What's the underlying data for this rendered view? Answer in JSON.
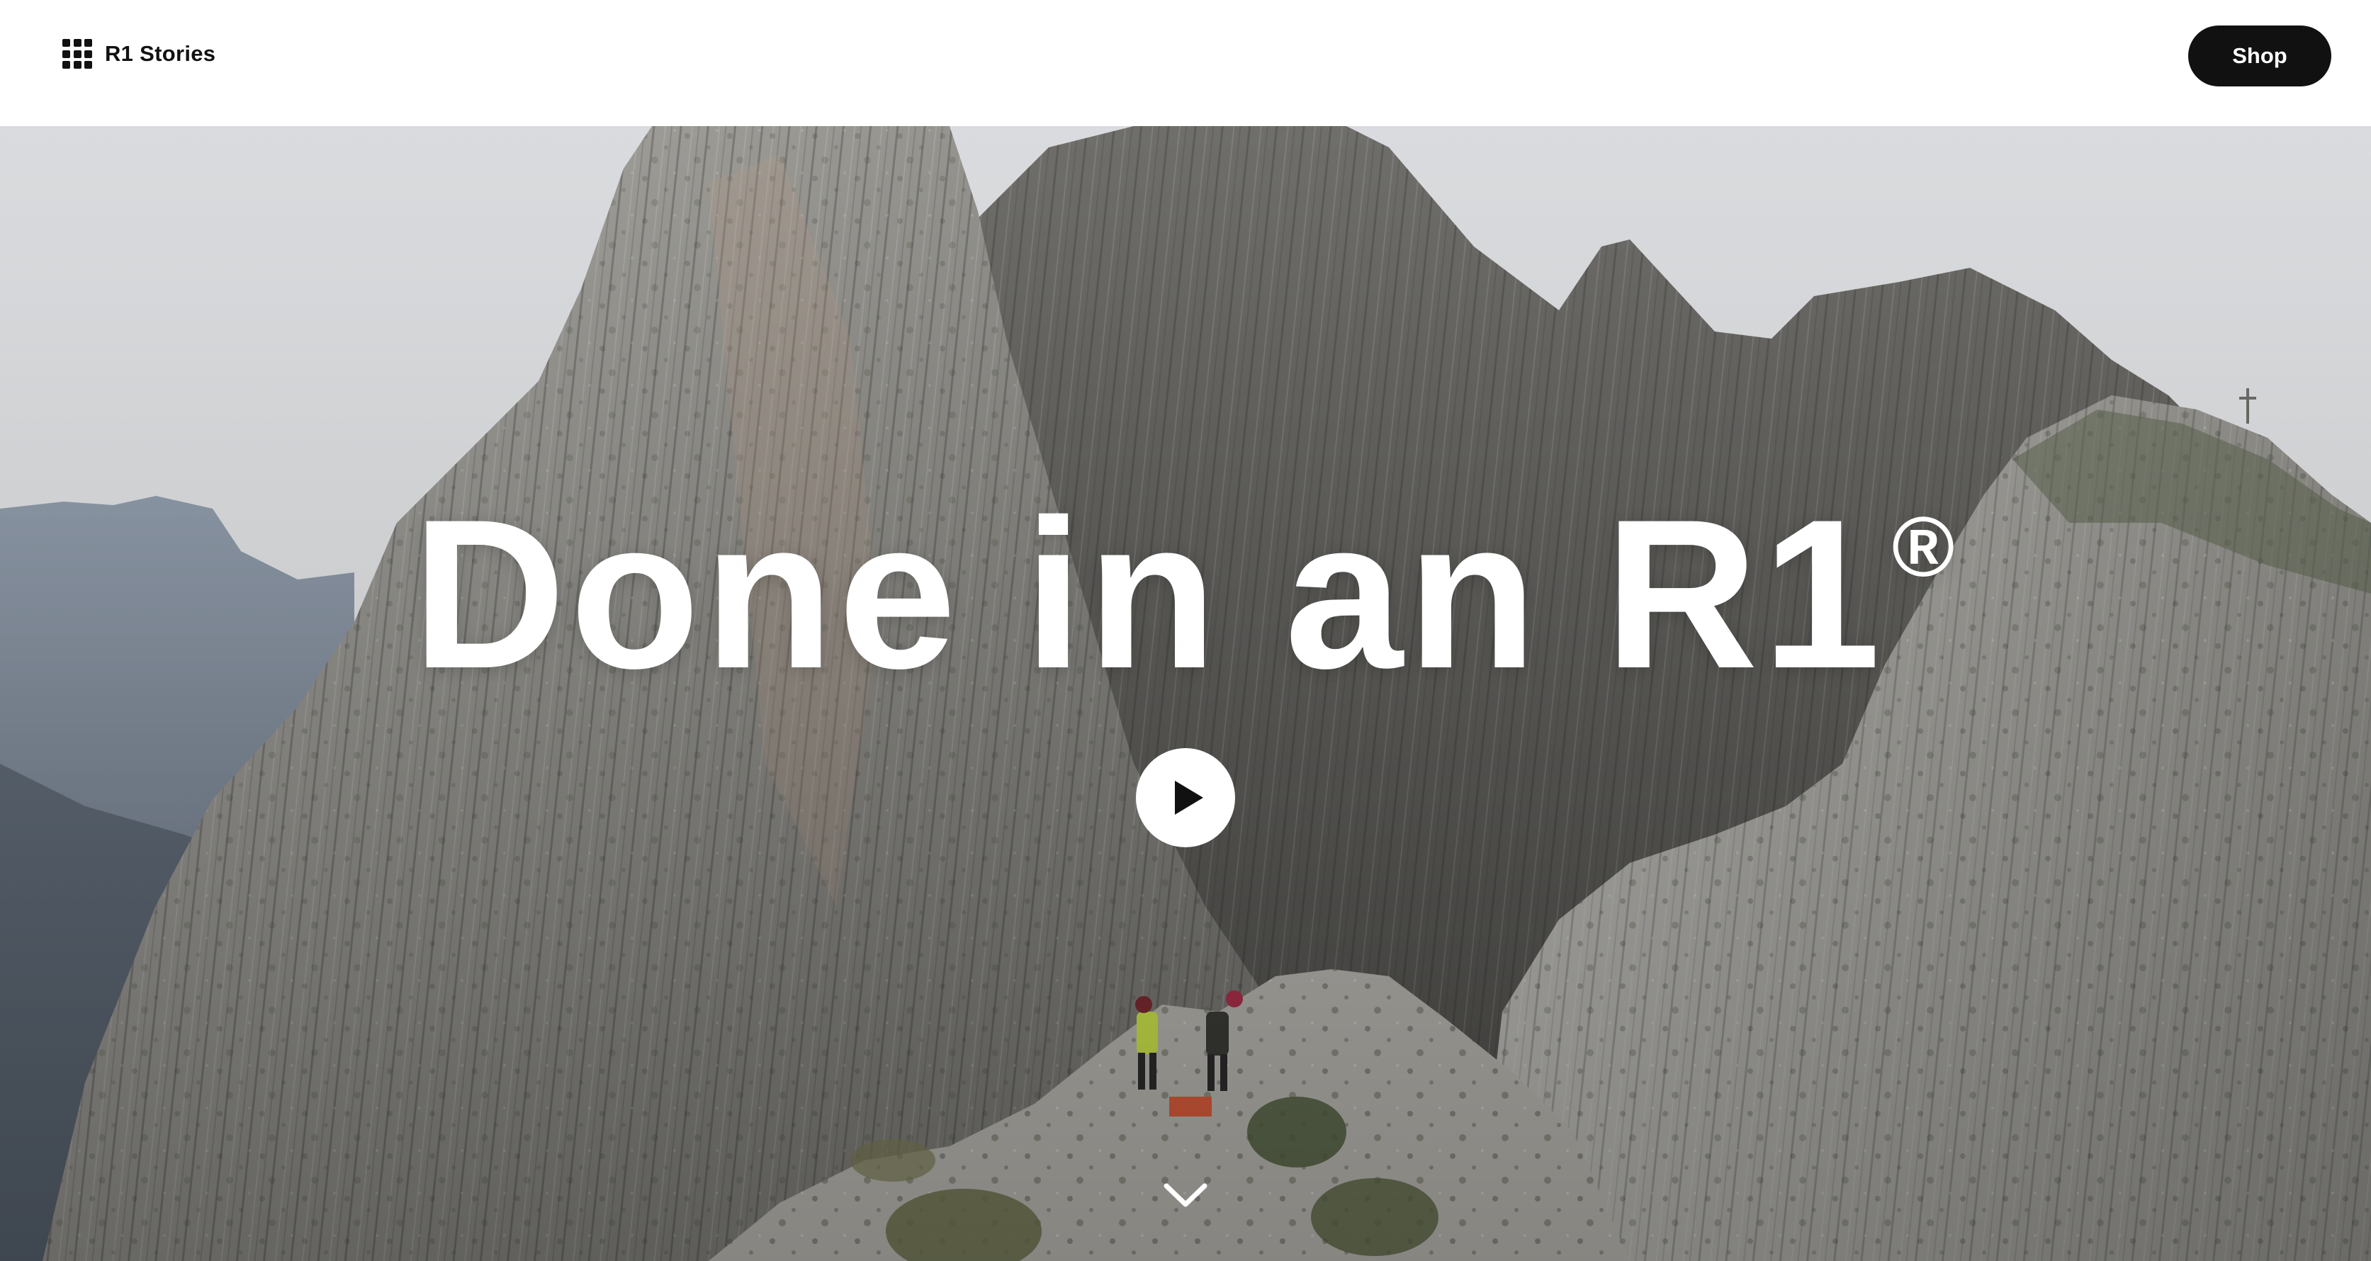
{
  "header": {
    "brand_label": "R1 Stories",
    "brand_icon": "grid-icon",
    "shop_label": "Shop"
  },
  "hero": {
    "title": "Done in an R1",
    "title_mark": "®",
    "play_icon": "play-icon",
    "scroll_icon": "chevron-down-icon"
  },
  "colors": {
    "header_bg": "#ffffff",
    "text_dark": "#111111",
    "button_bg": "#111111",
    "hero_text": "#ffffff",
    "sky": "#dfe1e4",
    "rock": "#8f8f8b"
  }
}
